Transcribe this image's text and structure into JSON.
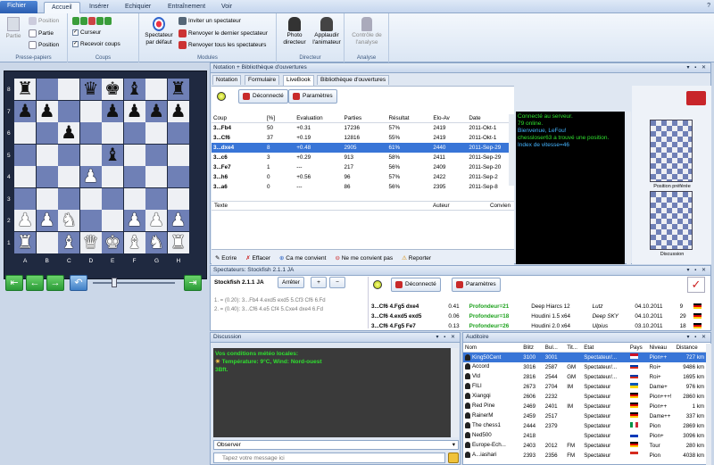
{
  "menu": {
    "tabs": [
      "Fichier",
      "Accueil",
      "Insérer",
      "Echiquier",
      "Entraînement",
      "Voir"
    ],
    "active": "Accueil"
  },
  "ribbon": {
    "presse_papiers": {
      "label": "Presse-papiers",
      "partie_big": "Partie",
      "items": [
        "Position",
        "Partie",
        "Position"
      ]
    },
    "coups": {
      "label": "Coups",
      "curseur": "Curseur",
      "recevoir": "Recevoir coups"
    },
    "modules": {
      "label": "Modules",
      "spectateur": "Spectateur par défaut",
      "inviter": "Inviter un spectateur",
      "renvoyer_dernier": "Renvoyer le dernier spectateur",
      "renvoyer_tous": "Renvoyer tous les spectateurs"
    },
    "directeur": {
      "label": "Directeur",
      "photo": "Photo directeur",
      "applaudir": "Applaudir l'animateur"
    },
    "analyse": {
      "label": "Analyse",
      "controle": "Contrôle de l'analyse"
    }
  },
  "board": {
    "files": [
      "A",
      "B",
      "C",
      "D",
      "E",
      "F",
      "G",
      "H"
    ],
    "ranks": [
      "8",
      "7",
      "6",
      "5",
      "4",
      "3",
      "2",
      "1"
    ],
    "position": [
      [
        "bR",
        "",
        "",
        "bQ",
        "bK",
        "bB",
        "",
        "bR"
      ],
      [
        "bP",
        "bP",
        "",
        "",
        "bP",
        "bP",
        "bP",
        "bP"
      ],
      [
        "",
        "",
        "bP",
        "",
        "",
        "",
        "",
        ""
      ],
      [
        "",
        "",
        "",
        "",
        "bB",
        "",
        "",
        ""
      ],
      [
        "",
        "",
        "",
        "wP",
        "",
        "",
        "",
        ""
      ],
      [
        "",
        "",
        "",
        "",
        "",
        "",
        "",
        ""
      ],
      [
        "wP",
        "wP",
        "wN",
        "",
        "",
        "wP",
        "wP",
        "wP"
      ],
      [
        "wR",
        "",
        "wB",
        "wQ",
        "wK",
        "wB",
        "wN",
        "wR"
      ]
    ]
  },
  "notation": {
    "title": "Notation + Bibliothèque d'ouvertures",
    "tabs": [
      "Notation",
      "Formulaire",
      "LiveBook",
      "Bibliothèque d'ouvertures"
    ],
    "active_tab": "LiveBook",
    "status_btn": "Déconnecté",
    "params_btn": "Paramètres",
    "columns": [
      "Coup",
      "[%]",
      "Evaluation",
      "Parties",
      "Résultat",
      "Elo-Av",
      "Date"
    ],
    "rows": [
      [
        "3...Fb4",
        "50",
        "+0.31",
        "17236",
        "57%",
        "2419",
        "2011-Okt-1"
      ],
      [
        "3...Cf6",
        "37",
        "+0.19",
        "12816",
        "55%",
        "2419",
        "2011-Okt-1"
      ],
      [
        "3...dxe4",
        "8",
        "+0.48",
        "2905",
        "61%",
        "2440",
        "2011-Sep-29"
      ],
      [
        "3...c6",
        "3",
        "+0.29",
        "913",
        "58%",
        "2411",
        "2011-Sep-29"
      ],
      [
        "3...Fe7",
        "1",
        "---",
        "217",
        "56%",
        "2409",
        "2011-Sep-20"
      ],
      [
        "3...h6",
        "0",
        "+0.56",
        "96",
        "57%",
        "2422",
        "2011-Sep-2"
      ],
      [
        "3...a6",
        "0",
        "---",
        "86",
        "56%",
        "2395",
        "2011-Sep-8"
      ]
    ],
    "selected_row": 2,
    "comment_cols": [
      "Texte",
      "Auteur",
      "Convien"
    ],
    "actions": [
      "Ecrire",
      "Effacer",
      "Ca me convient",
      "Ne me convient pas",
      "Reporter"
    ]
  },
  "server_chat": [
    {
      "text": "Connecté au serveur.",
      "color": "green"
    },
    {
      "text": "79 online.",
      "color": "green"
    },
    {
      "text": "Bienvenue, LeFou!",
      "color": "cyan"
    },
    {
      "text": "chessloser63 a trouvé une position.",
      "color": "green"
    },
    {
      "text": "Index de vitesse=46",
      "color": "cyan"
    }
  ],
  "thumbs": {
    "label1": "Position préférée",
    "label2": "Discussion"
  },
  "spectators": {
    "title": "Spectateurs: Stockfish 2.1.1 JA",
    "engine": "Stockfish 2.1.1 JA",
    "stop": "Arrêter",
    "lines": [
      "1. = (0.20): 3...Fb4 4.exd5 exd5 5.Cf3 Cf6 6.Fd",
      "2. = (0.40): 3...Cf6 4.e5 Cf4 5.Cxe4 dxe4 6.Fd"
    ],
    "status_btn": "Déconnecté",
    "params_btn": "Paramètres",
    "results": [
      {
        "line": "3...Cf6 4.Fg5 dxe4",
        "eval": "0.41",
        "depth": "Profondeur=21",
        "engine": "Deep Hiarcs 12",
        "user": "Lutz",
        "date": "04.10.2011",
        "n": "9"
      },
      {
        "line": "3...Cf6 4.exd5 exd5",
        "eval": "0.06",
        "depth": "Profondeur=18",
        "engine": "Houdini 1.5 x64",
        "user": "Deep SKY",
        "date": "04.10.2011",
        "n": "29"
      },
      {
        "line": "3...Cf6 4.Fg5 Fe7",
        "eval": "0.13",
        "depth": "Profondeur=26",
        "engine": "Houdini 2.0 x64",
        "user": "Ulpius",
        "date": "03.10.2011",
        "n": "18"
      }
    ]
  },
  "discussion": {
    "title": "Discussion",
    "lines": [
      "Vos conditions météo locales:",
      "Température: 9°C, Wind: Nord-ouest",
      "3Bft."
    ],
    "mode": "Observer",
    "placeholder": "Tapez votre message ici"
  },
  "auditoire": {
    "title": "Auditoire",
    "columns": [
      "Nom",
      "Blitz",
      "Bul...",
      "Tit...",
      "Etat",
      "Pays",
      "Niveau",
      "Distance"
    ],
    "rows": [
      [
        "King50Cent",
        "3100",
        "3001",
        "",
        "Spectateur/...",
        "",
        "Pion++",
        "727 km"
      ],
      [
        "Accord",
        "3016",
        "2587",
        "GM",
        "Spectateur/...",
        "",
        "Roi+",
        "9486 km"
      ],
      [
        "Vld",
        "2816",
        "2544",
        "GM",
        "Spectateur/...",
        "",
        "Roi+",
        "1695 km"
      ],
      [
        "FILI",
        "2673",
        "2704",
        "IM",
        "Spectateur",
        "",
        "Dame+",
        "976 km"
      ],
      [
        "Xiangqi",
        "2606",
        "2232",
        "",
        "Spectateur",
        "",
        "Pion+++!",
        "2860 km"
      ],
      [
        "Red Pine",
        "2469",
        "2401",
        "IM",
        "Spectateur",
        "",
        "Pion++",
        "1 km"
      ],
      [
        "RainerM",
        "2459",
        "2517",
        "",
        "Spectateur",
        "",
        "Dame++",
        "337 km"
      ],
      [
        "The chess1",
        "2444",
        "2379",
        "",
        "Spectateur",
        "",
        "Pion",
        "2869 km"
      ],
      [
        "Ned500",
        "2418",
        "",
        "",
        "Spectateur",
        "",
        "Pion+",
        "3096 km"
      ],
      [
        "Europe-Ech...",
        "2403",
        "2012",
        "FM",
        "Spectateur",
        "",
        "Tour",
        "280 km"
      ],
      [
        "A...iashari",
        "2393",
        "2356",
        "FM",
        "Spectateur",
        "",
        "Pion",
        "4038 km"
      ]
    ],
    "selected_row": 0
  }
}
